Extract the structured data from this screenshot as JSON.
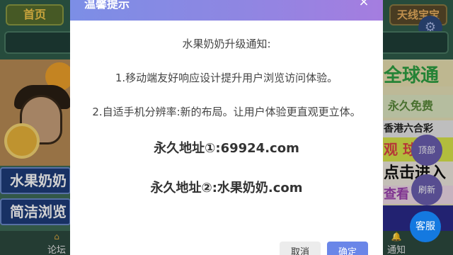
{
  "nav": {
    "home_label": "首页",
    "right_label": "天线宝宝"
  },
  "left": {
    "buttons": [
      "水果奶奶",
      "简洁浏览"
    ]
  },
  "right_column": {
    "rows": [
      "全球通",
      "永久免费",
      "香港六合彩",
      "观 球 盘",
      "点击进入",
      "查看"
    ]
  },
  "floating": {
    "top_label": "顶部",
    "refresh_label": "刷新",
    "service_label": "客服"
  },
  "bottom_nav": {
    "forum_label": "论坛",
    "notice_label": "通知"
  },
  "modal": {
    "title": "温馨提示",
    "close_symbol": "×",
    "heading": "水果奶奶升级通知:",
    "line1": "1.移动端友好响应设计提升用户浏览访问体验。",
    "line2": "2.自适手机分辨率:新的布局。让用户体验更直观更立体。",
    "address1": "永久地址①:69924.com",
    "address2": "永久地址②:水果奶奶.com",
    "cancel_label": "取消",
    "confirm_label": "确定"
  },
  "colors": {
    "header_gradient_start": "#7c8ee6",
    "header_gradient_end": "#a57de0",
    "confirm_button": "#6a86e8",
    "service_button": "#1479e0"
  }
}
